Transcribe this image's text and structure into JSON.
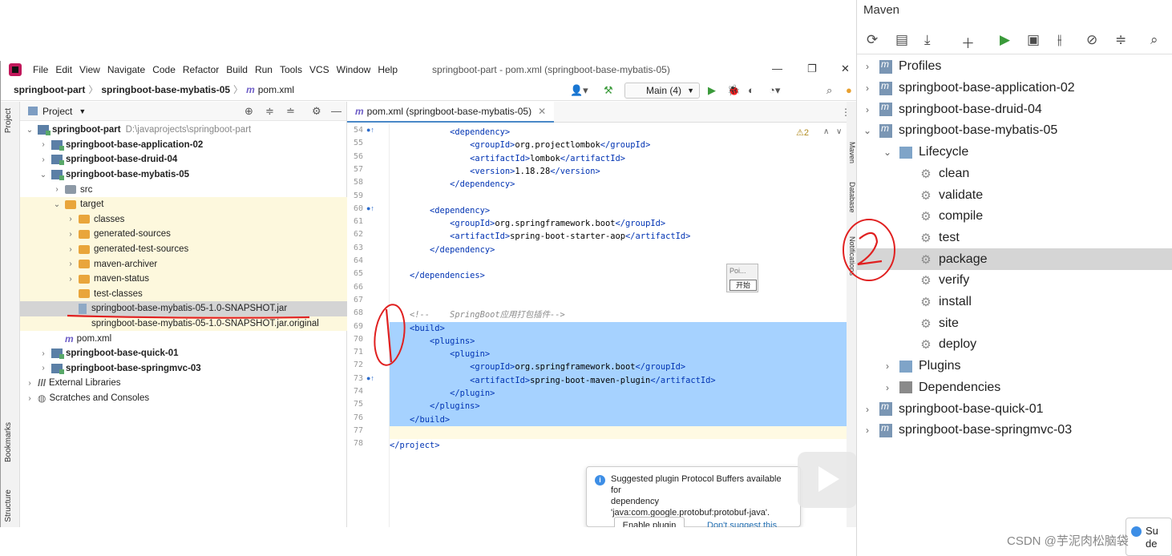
{
  "ide": {
    "menu": [
      "File",
      "Edit",
      "View",
      "Navigate",
      "Code",
      "Refactor",
      "Build",
      "Run",
      "Tools",
      "VCS",
      "Window",
      "Help"
    ],
    "window_title": "springboot-part - pom.xml (springboot-base-mybatis-05)",
    "breadcrumb": [
      "springboot-part",
      "springboot-base-mybatis-05",
      "pom.xml"
    ],
    "run_config": "Main (4)",
    "project_label": "Project",
    "left_strip": {
      "project": "Project",
      "bookmarks": "Bookmarks",
      "structure": "Structure"
    },
    "right_strip": {
      "maven": "Maven",
      "database": "Database",
      "notifications": "Notifications"
    },
    "tree": [
      {
        "label": "springboot-part",
        "extra": "D:\\javaprojects\\springboot-part",
        "kind": "module",
        "bold": true,
        "depth": 0,
        "chev": "v"
      },
      {
        "label": "springboot-base-application-02",
        "kind": "module",
        "bold": true,
        "depth": 1,
        "chev": ">"
      },
      {
        "label": "springboot-base-druid-04",
        "kind": "module",
        "bold": true,
        "depth": 1,
        "chev": ">"
      },
      {
        "label": "springboot-base-mybatis-05",
        "kind": "module",
        "bold": true,
        "depth": 1,
        "chev": "v"
      },
      {
        "label": "src",
        "kind": "folder-gray",
        "depth": 2,
        "chev": ">"
      },
      {
        "label": "target",
        "kind": "folder",
        "depth": 2,
        "chev": "v",
        "yellow": true
      },
      {
        "label": "classes",
        "kind": "folder",
        "depth": 3,
        "chev": ">",
        "yellow": true
      },
      {
        "label": "generated-sources",
        "kind": "folder",
        "depth": 3,
        "chev": ">",
        "yellow": true
      },
      {
        "label": "generated-test-sources",
        "kind": "folder",
        "depth": 3,
        "chev": ">",
        "yellow": true
      },
      {
        "label": "maven-archiver",
        "kind": "folder",
        "depth": 3,
        "chev": ">",
        "yellow": true
      },
      {
        "label": "maven-status",
        "kind": "folder",
        "depth": 3,
        "chev": ">",
        "yellow": true
      },
      {
        "label": "test-classes",
        "kind": "folder",
        "depth": 3,
        "chev": "",
        "yellow": true
      },
      {
        "label": "springboot-base-mybatis-05-1.0-SNAPSHOT.jar",
        "kind": "jar",
        "depth": 3,
        "chev": "",
        "selected": true
      },
      {
        "label": "springboot-base-mybatis-05-1.0-SNAPSHOT.jar.original",
        "kind": "file",
        "depth": 3,
        "chev": "",
        "yellow": true
      },
      {
        "label": "pom.xml",
        "kind": "maven",
        "depth": 2,
        "chev": ""
      },
      {
        "label": "springboot-base-quick-01",
        "kind": "module",
        "bold": true,
        "depth": 1,
        "chev": ">"
      },
      {
        "label": "springboot-base-springmvc-03",
        "kind": "module",
        "bold": true,
        "depth": 1,
        "chev": ">"
      },
      {
        "label": "External Libraries",
        "kind": "lib",
        "depth": 0,
        "chev": ">"
      },
      {
        "label": "Scratches and Consoles",
        "kind": "scratch",
        "depth": 0,
        "chev": ">"
      }
    ],
    "editor_tab": "pom.xml (springboot-base-mybatis-05)",
    "warnings": "⚠2",
    "code": [
      {
        "n": "54",
        "t": "            <dependency>",
        "m": "●↑"
      },
      {
        "n": "55",
        "t": "                <groupId>org.projectlombok</groupId>"
      },
      {
        "n": "56",
        "t": "                <artifactId>lombok</artifactId>"
      },
      {
        "n": "57",
        "t": "                <version>1.18.28</version>"
      },
      {
        "n": "58",
        "t": "            </dependency>"
      },
      {
        "n": "59",
        "t": ""
      },
      {
        "n": "60",
        "t": "        <dependency>",
        "m": "●↑"
      },
      {
        "n": "61",
        "t": "            <groupId>org.springframework.boot</groupId>"
      },
      {
        "n": "62",
        "t": "            <artifactId>spring-boot-starter-aop</artifactId>"
      },
      {
        "n": "63",
        "t": "        </dependency>"
      },
      {
        "n": "64",
        "t": ""
      },
      {
        "n": "65",
        "t": "    </dependencies>"
      },
      {
        "n": "66",
        "t": ""
      },
      {
        "n": "67",
        "t": ""
      },
      {
        "n": "68",
        "t": "    <!--    SpringBoot应用打包插件-->",
        "c": true
      },
      {
        "n": "69",
        "t": "    <build>",
        "h": true
      },
      {
        "n": "70",
        "t": "        <plugins>",
        "h": true
      },
      {
        "n": "71",
        "t": "            <plugin>",
        "h": true
      },
      {
        "n": "72",
        "t": "                <groupId>org.springframework.boot</groupId>",
        "h": true
      },
      {
        "n": "73",
        "t": "                <artifactId>spring-boot-maven-plugin</artifactId>",
        "h": true,
        "m": "●↑"
      },
      {
        "n": "74",
        "t": "            </plugin>",
        "h": true
      },
      {
        "n": "75",
        "t": "        </plugins>",
        "h": true
      },
      {
        "n": "76",
        "t": "    </build>",
        "h": true
      },
      {
        "n": "77",
        "t": "",
        "cur": true
      },
      {
        "n": "78",
        "t": "</project>"
      }
    ],
    "mini_widget": {
      "title": "Poi...",
      "button": "开始"
    },
    "popup": {
      "text1": "Suggested plugin Protocol Buffers available for",
      "text2": "dependency",
      "text3": "'java:com.google.protobuf:protobuf-java'.",
      "btn": "Enable plugin",
      "link": "Don't suggest this plugin"
    }
  },
  "maven": {
    "title": "Maven",
    "items": [
      {
        "label": "Profiles",
        "kind": "profiles",
        "depth": 0,
        "chev": ">"
      },
      {
        "label": "springboot-base-application-02",
        "kind": "module",
        "depth": 0,
        "chev": ">"
      },
      {
        "label": "springboot-base-druid-04",
        "kind": "module",
        "depth": 0,
        "chev": ">"
      },
      {
        "label": "springboot-base-mybatis-05",
        "kind": "module",
        "depth": 0,
        "chev": "v"
      },
      {
        "label": "Lifecycle",
        "kind": "lifecycle",
        "depth": 1,
        "chev": "v"
      },
      {
        "label": "clean",
        "kind": "goal",
        "depth": 2
      },
      {
        "label": "validate",
        "kind": "goal",
        "depth": 2
      },
      {
        "label": "compile",
        "kind": "goal",
        "depth": 2
      },
      {
        "label": "test",
        "kind": "goal",
        "depth": 2
      },
      {
        "label": "package",
        "kind": "goal",
        "depth": 2,
        "selected": true
      },
      {
        "label": "verify",
        "kind": "goal",
        "depth": 2
      },
      {
        "label": "install",
        "kind": "goal",
        "depth": 2
      },
      {
        "label": "site",
        "kind": "goal",
        "depth": 2
      },
      {
        "label": "deploy",
        "kind": "goal",
        "depth": 2
      },
      {
        "label": "Plugins",
        "kind": "lifecycle",
        "depth": 1,
        "chev": ">"
      },
      {
        "label": "Dependencies",
        "kind": "deps",
        "depth": 1,
        "chev": ">"
      },
      {
        "label": "springboot-base-quick-01",
        "kind": "module",
        "depth": 0,
        "chev": ">"
      },
      {
        "label": "springboot-base-springmvc-03",
        "kind": "module",
        "depth": 0,
        "chev": ">"
      }
    ]
  },
  "bottom_card": {
    "line1": "Su",
    "line2": "de"
  },
  "watermark": "CSDN @芋泥肉松脑袋",
  "colors": {
    "selection": "#a6d2ff",
    "accent": "#4a88c7",
    "annotation": "#e02020"
  }
}
